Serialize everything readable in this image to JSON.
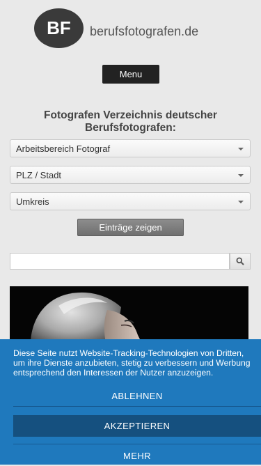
{
  "header": {
    "logo_initials": "BF",
    "logo_text": "berufsfotografen.de"
  },
  "nav": {
    "menu_label": "Menu"
  },
  "main": {
    "heading": "Fotografen Verzeichnis deutscher Berufsfotografen:",
    "selects": [
      {
        "value": "Arbeitsbereich Fotograf"
      },
      {
        "value": "PLZ / Stadt"
      },
      {
        "value": "Umkreis"
      }
    ],
    "show_button": "Einträge zeigen",
    "search": {
      "placeholder": "",
      "icon": "search-icon"
    }
  },
  "cookie_banner": {
    "lines": [
      "Diese Seite nutzt Website-Tracking-Technologien von Dritten,",
      "um ihre Dienste anzubieten, stetig zu verbessern und Werbung",
      "entsprechend den Interessen der Nutzer anzuzeigen."
    ],
    "decline_label": "ABLEHNEN",
    "accept_label": "AKZEPTIEREN",
    "more_label": "MEHR",
    "colors": {
      "background": "#1f79bd",
      "accept_background": "#15507f"
    }
  }
}
